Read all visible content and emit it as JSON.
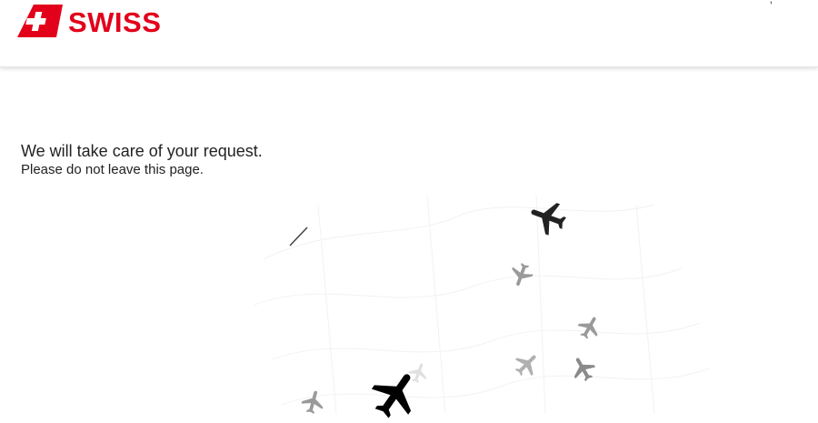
{
  "header": {
    "logo_text": "SWISS",
    "util_text": ", ",
    "brand_color": "#e2001a"
  },
  "message": {
    "title": "We will take care of your request.",
    "subtitle": "Please do not leave this page."
  },
  "animation": {
    "icon": "airplane-icon",
    "planes": [
      {
        "shade": "#222222"
      },
      {
        "shade": "#9a9a9a"
      },
      {
        "shade": "#9a9a9a"
      },
      {
        "shade": "#a5a5a5"
      },
      {
        "shade": "#8a8a8a"
      },
      {
        "shade": "#000000"
      },
      {
        "shade": "#9a9a9a"
      },
      {
        "shade": "#e0e0e0"
      },
      {
        "shade": "#333333"
      }
    ]
  }
}
